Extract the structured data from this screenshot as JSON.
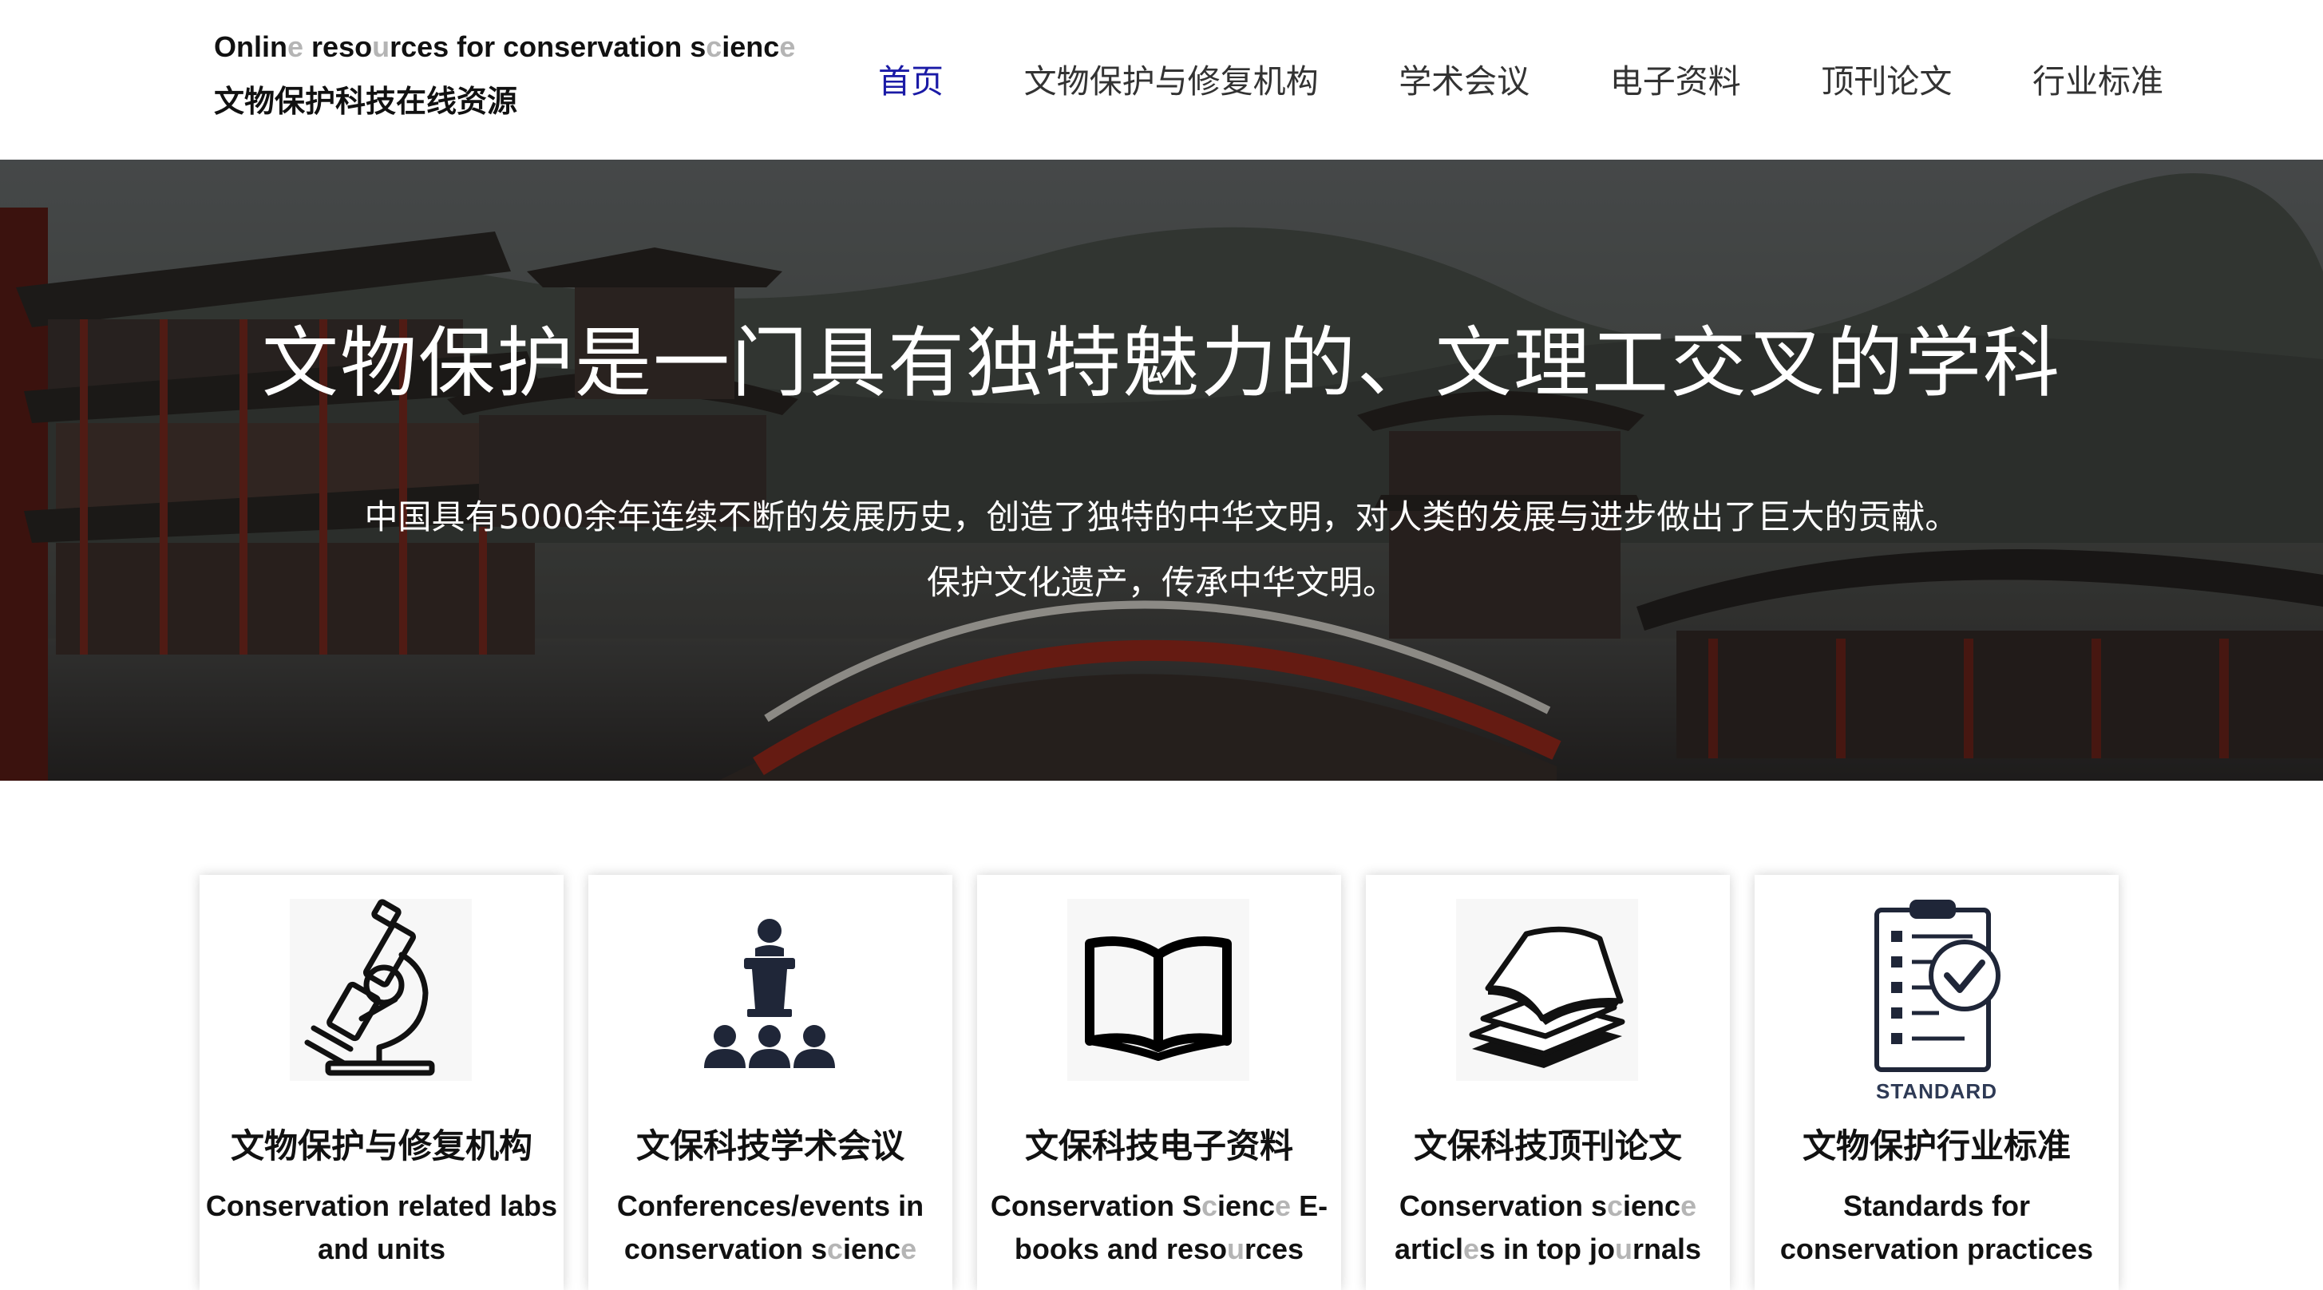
{
  "header": {
    "brand_en_parts": [
      {
        "text": "Onlin",
        "faint": false
      },
      {
        "text": "e",
        "faint": true
      },
      {
        "text": " reso",
        "faint": false
      },
      {
        "text": "u",
        "faint": true
      },
      {
        "text": "rces for conservation s",
        "faint": false
      },
      {
        "text": "c",
        "faint": true
      },
      {
        "text": "ienc",
        "faint": false
      },
      {
        "text": "e",
        "faint": true
      }
    ],
    "brand_zh": "文物保护科技在线资源"
  },
  "nav": [
    {
      "label": "首页",
      "active": true
    },
    {
      "label": "文物保护与修复机构",
      "active": false
    },
    {
      "label": "学术会议",
      "active": false
    },
    {
      "label": "电子资料",
      "active": false
    },
    {
      "label": "顶刊论文",
      "active": false
    },
    {
      "label": "行业标准",
      "active": false
    }
  ],
  "hero": {
    "title": "文物保护是一门具有独特魅力的、文理工交叉的学科",
    "line1": "中国具有5000余年连续不断的发展历史，创造了独特的中华文明，对人类的发展与进步做出了巨大的贡献。",
    "line2": "保护文化遗产，传承中华文明。"
  },
  "cards": [
    {
      "icon": "microscope-icon",
      "kicker": "",
      "title": "文物保护与修复机构",
      "desc_lines": [
        [
          {
            "text": "Conservation  related labs",
            "faint": false
          }
        ],
        [
          {
            "text": "and units",
            "faint": false
          }
        ]
      ]
    },
    {
      "icon": "conference-speaker-icon",
      "kicker": "",
      "title": "文保科技学术会议",
      "desc_lines": [
        [
          {
            "text": "Conferences/events in",
            "faint": false
          }
        ],
        [
          {
            "text": "conservation s",
            "faint": false
          },
          {
            "text": "c",
            "faint": true
          },
          {
            "text": "ienc",
            "faint": false
          },
          {
            "text": "e",
            "faint": true
          }
        ]
      ]
    },
    {
      "icon": "open-book-icon",
      "kicker": "",
      "title": "文保科技电子资料",
      "desc_lines": [
        [
          {
            "text": "Conservation S",
            "faint": false
          },
          {
            "text": "c",
            "faint": true
          },
          {
            "text": "ienc",
            "faint": false
          },
          {
            "text": "e",
            "faint": true
          },
          {
            "text": " E-",
            "faint": false
          }
        ],
        [
          {
            "text": "books and reso",
            "faint": false
          },
          {
            "text": "u",
            "faint": true
          },
          {
            "text": "rces",
            "faint": false
          }
        ]
      ]
    },
    {
      "icon": "paper-stack-icon",
      "kicker": "",
      "title": "文保科技顶刊论文",
      "desc_lines": [
        [
          {
            "text": "Conservation s",
            "faint": false
          },
          {
            "text": "c",
            "faint": true
          },
          {
            "text": "ienc",
            "faint": false
          },
          {
            "text": "e",
            "faint": true
          }
        ],
        [
          {
            "text": "articl",
            "faint": false
          },
          {
            "text": "e",
            "faint": true
          },
          {
            "text": "s in top jo",
            "faint": false
          },
          {
            "text": "u",
            "faint": true
          },
          {
            "text": "rnals",
            "faint": false
          }
        ]
      ]
    },
    {
      "icon": "clipboard-check-icon",
      "kicker": "STANDARD",
      "title": "文物保护行业标准",
      "desc_lines": [
        [
          {
            "text": "Standards for",
            "faint": false
          }
        ],
        [
          {
            "text": "conservation practices",
            "faint": false
          }
        ]
      ]
    }
  ],
  "colors": {
    "nav_active": "#1a1aa6",
    "nav_text": "#333333",
    "icon_dark": "#1f2638",
    "faint_text": "#b5b5b5"
  }
}
